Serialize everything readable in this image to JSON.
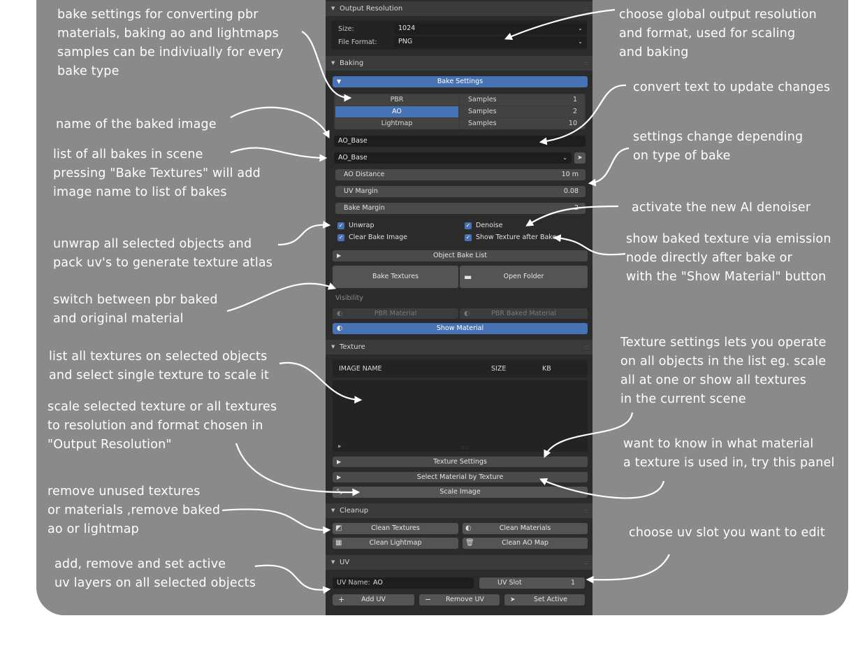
{
  "annotations": {
    "bake_settings": "bake settings for converting pbr\nmaterials, baking ao and lightmaps\nsamples can be indiviually for every\nbake type",
    "name_baked": "name of the baked image",
    "list_bakes": "list of all bakes in scene\npressing \"Bake Textures\" will add\nimage name to list of bakes",
    "unwrap": "unwrap all selected objects and\npack uv's to generate texture atlas",
    "switch": "switch between pbr baked\nand original material",
    "list_textures": "list all textures on selected objects\nand select single texture to scale it",
    "scale_selected": "scale selected texture or all textures\nto resolution and format chosen in\n\"Output Resolution\"",
    "remove_unused": "remove unused textures\nor materials ,remove baked\nao or lightmap",
    "uv_layers": "add, remove and set active\nuv layers on all selected objects",
    "global_res": "choose global output resolution\nand format, used for scaling\nand baking",
    "convert_text": "convert text to update changes",
    "settings_change": "settings change depending\non type of bake",
    "denoiser": "activate the new AI denoiser",
    "show_baked": "show baked texture via emission\nnode directly after bake or\nwith the \"Show Material\" button",
    "texture_settings": "Texture settings lets you operate\non all objects in the list eg. scale\nall at one or show all textures\nin the current scene",
    "material_lookup": "want to know in what material\na texture is used in, try this panel",
    "uv_slot": "choose uv slot you want to edit"
  },
  "panel": {
    "output_resolution": {
      "title": "Output Resolution",
      "size_label": "Size:",
      "size_value": "1024",
      "format_label": "File Format:",
      "format_value": "PNG"
    },
    "baking": {
      "title": "Baking",
      "bake_settings": "Bake Settings",
      "bake_types": [
        {
          "name": "PBR",
          "samples_label": "Samples",
          "samples": "1"
        },
        {
          "name": "AO",
          "samples_label": "Samples",
          "samples": "2"
        },
        {
          "name": "Lightmap",
          "samples_label": "Samples",
          "samples": "10"
        }
      ],
      "image_name": "AO_Base",
      "bake_list_value": "AO_Base",
      "ao_distance_label": "AO Distance",
      "ao_distance_value": "10 m",
      "uv_margin_label": "UV Margin",
      "uv_margin_value": "0.08",
      "bake_margin_label": "Bake Margin",
      "bake_margin_value": "2",
      "unwrap": "Unwrap",
      "denoise": "Denoise",
      "clear_bake_image": "Clear Bake Image",
      "show_texture_after_bake": "Show Texture after Bake",
      "object_bake_list": "Object Bake List",
      "bake_textures": "Bake Textures",
      "open_folder": "Open Folder",
      "visibility": "Visibility",
      "pbr_material": "PBR Material",
      "pbr_baked_material": "PBR Baked Material",
      "show_material": "Show Material"
    },
    "texture": {
      "title": "Texture",
      "col_image_name": "IMAGE NAME",
      "col_size": "SIZE",
      "col_kb": "KB",
      "texture_settings": "Texture Settings",
      "select_material": "Select Material by Texture",
      "scale_image": "Scale Image"
    },
    "cleanup": {
      "title": "Cleanup",
      "clean_textures": "Clean Textures",
      "clean_materials": "Clean Materials",
      "clean_lightmap": "Clean Lightmap",
      "clean_ao_map": "Clean AO Map"
    },
    "uv": {
      "title": "UV",
      "uv_name_label": "UV Name:",
      "uv_name_value": "AO",
      "uv_slot_label": "UV Slot",
      "uv_slot_value": "1",
      "add_uv": "Add UV",
      "remove_uv": "Remove UV",
      "set_active": "Set Active"
    }
  },
  "colors": {
    "backdrop": "#8a8a8a",
    "accent": "#4772b3",
    "panel_bg": "#2b2b2b"
  },
  "icons": [
    "chevron-down-icon",
    "eyedropper-icon",
    "folder-icon",
    "material-sphere-icon",
    "texture-icon",
    "lightmap-icon",
    "trash-icon",
    "plus-icon",
    "minus-icon",
    "cursor-icon",
    "scale-icon"
  ]
}
